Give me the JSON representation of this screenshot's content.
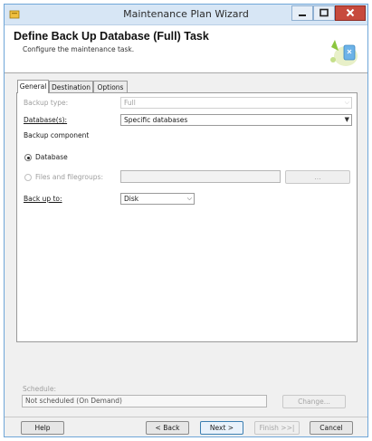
{
  "window": {
    "title": "Maintenance Plan Wizard"
  },
  "header": {
    "title": "Define Back Up Database (Full) Task",
    "subtitle": "Configure the maintenance task."
  },
  "tabs": [
    {
      "label": "General",
      "active": true
    },
    {
      "label": "Destination",
      "active": false
    },
    {
      "label": "Options",
      "active": false
    }
  ],
  "form": {
    "backup_type_label": "Backup type:",
    "backup_type_value": "Full",
    "databases_label": "Database(s):",
    "databases_value": "Specific databases",
    "backup_component_label": "Backup component",
    "radio_database_label": "Database",
    "radio_files_label": "Files and filegroups:",
    "files_browse_label": "...",
    "back_up_to_label": "Back up to:",
    "back_up_to_value": "Disk"
  },
  "schedule": {
    "label": "Schedule:",
    "value": "Not scheduled (On Demand)",
    "change_label": "Change..."
  },
  "footer": {
    "help": "Help",
    "back": "< Back",
    "next": "Next >",
    "finish": "Finish >>|",
    "cancel": "Cancel"
  },
  "colors": {
    "titlebar": "#d7e6f5",
    "close_button": "#c74a3d",
    "window_border": "#6fa6d8"
  }
}
